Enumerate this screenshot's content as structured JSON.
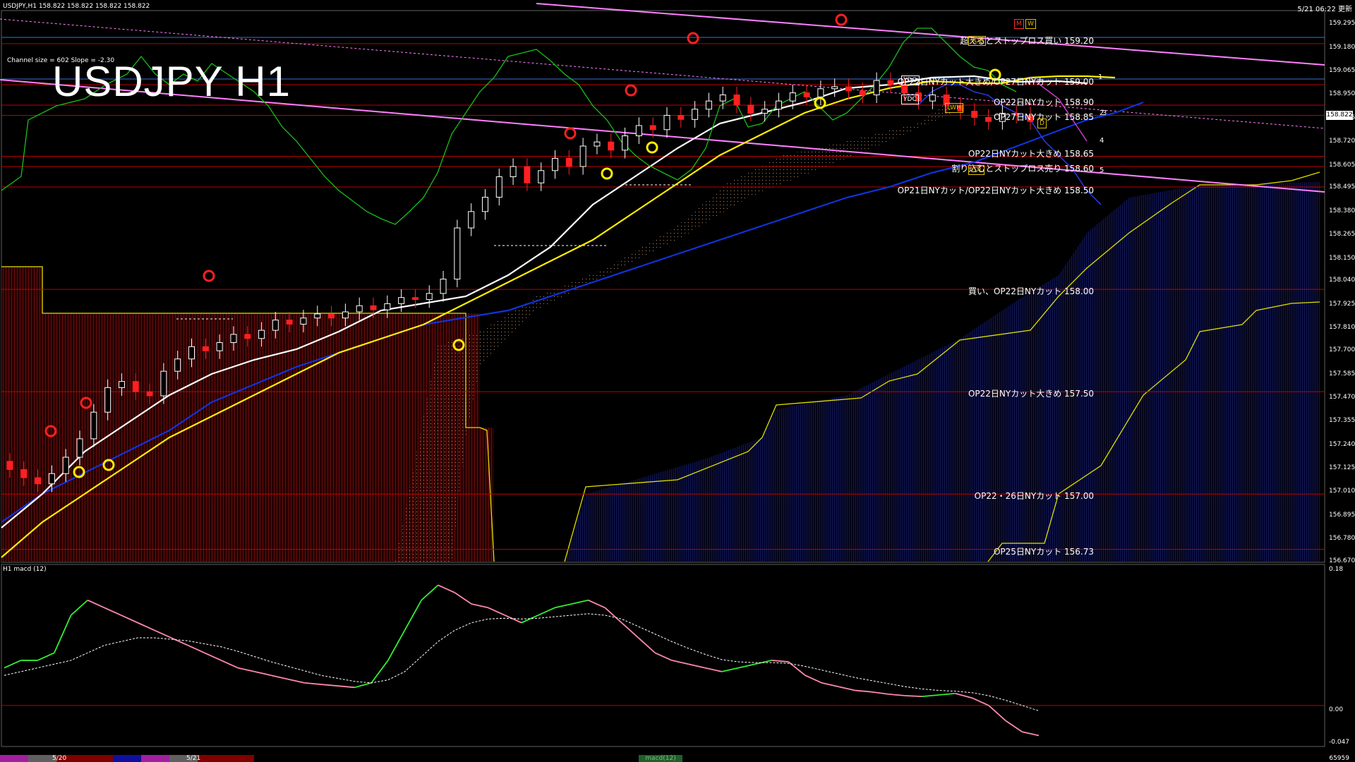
{
  "header": {
    "symbol_info": "USDJPY,H1  158.822 158.822 158.822 158.822",
    "datetime": "5/21 06:22 更新",
    "channel_info": "Channel size = 602 Slope = -2.30",
    "title": "USDJPY H1"
  },
  "macd_panel": {
    "title": "H1  macd (12)",
    "ticks": [
      "0.18",
      "0.00",
      "-0.047"
    ],
    "tab_label": "macd(12)"
  },
  "price_axis": {
    "ticks": [
      "159.295",
      "159.180",
      "159.065",
      "158.950",
      "158.835",
      "158.720",
      "158.605",
      "158.495",
      "158.380",
      "158.265",
      "158.150",
      "158.040",
      "157.925",
      "157.810",
      "157.700",
      "157.585",
      "157.470",
      "157.355",
      "157.240",
      "157.125",
      "157.010",
      "156.895",
      "156.780",
      "156.670"
    ],
    "current_price": "158.822"
  },
  "levels": [
    {
      "label": "超えるとストップロス買い 159.20",
      "price": 159.2
    },
    {
      "label": "OP22日NYカット大きめ/OP27日NYカット 159.00",
      "price": 159.0
    },
    {
      "label": "OP22日NYカット 158.90",
      "price": 158.9
    },
    {
      "label": "OP27日NYカット 158.85",
      "price": 158.85
    },
    {
      "label": "OP22日NYカット大きめ 158.65",
      "price": 158.65
    },
    {
      "label": "割り込むとストップロス売り 158.60",
      "price": 158.6
    },
    {
      "label": "OP21日NYカット/OP22日NYカット大きめ 158.50",
      "price": 158.5
    },
    {
      "label": "買い、OP22日NYカット 158.00",
      "price": 158.0
    },
    {
      "label": "OP22日NYカット大きめ 157.50",
      "price": 157.5
    },
    {
      "label": "OP22・26日NYカット 157.00",
      "price": 157.0
    },
    {
      "label": "OP25日NYカット 156.73",
      "price": 156.73
    }
  ],
  "markers": {
    "ydh": "YDH",
    "ydo": "YDO",
    "ydc": "YDC",
    "ydl": "YDL",
    "lwh": "LWH",
    "m": "M",
    "w": "W",
    "d": "D",
    "wave_labels": [
      "1",
      "2",
      "3",
      "4",
      "5"
    ]
  },
  "bottom_bar": {
    "dates": [
      "5/20",
      "5/21"
    ],
    "right_number": "65959"
  },
  "chart_data": {
    "type": "candlestick",
    "symbol": "USDJPY",
    "timeframe": "H1",
    "ylim": [
      156.67,
      159.31
    ],
    "closes": [
      157.12,
      157.08,
      157.05,
      157.1,
      157.18,
      157.27,
      157.4,
      157.52,
      157.55,
      157.5,
      157.48,
      157.6,
      157.66,
      157.72,
      157.7,
      157.74,
      157.78,
      157.76,
      157.8,
      157.85,
      157.83,
      157.86,
      157.88,
      157.86,
      157.89,
      157.92,
      157.9,
      157.93,
      157.96,
      157.95,
      157.98,
      158.05,
      158.3,
      158.38,
      158.45,
      158.55,
      158.6,
      158.52,
      158.58,
      158.64,
      158.6,
      158.7,
      158.72,
      158.68,
      158.75,
      158.8,
      158.78,
      158.85,
      158.83,
      158.88,
      158.92,
      158.95,
      158.9,
      158.86,
      158.88,
      158.92,
      158.96,
      158.94,
      158.98,
      158.99,
      158.97,
      158.95,
      159.02,
      159.0,
      158.96,
      158.92,
      158.95,
      158.9,
      158.87,
      158.84,
      158.82,
      158.86,
      158.85,
      158.82
    ],
    "hull_midline": [],
    "macd": {
      "main": [
        0.05,
        0.06,
        0.06,
        0.07,
        0.12,
        0.14,
        0.13,
        0.12,
        0.11,
        0.1,
        0.09,
        0.08,
        0.07,
        0.06,
        0.05,
        0.045,
        0.04,
        0.035,
        0.03,
        0.028,
        0.026,
        0.024,
        0.03,
        0.06,
        0.1,
        0.14,
        0.16,
        0.15,
        0.135,
        0.13,
        0.12,
        0.11,
        0.12,
        0.13,
        0.135,
        0.14,
        0.13,
        0.11,
        0.09,
        0.07,
        0.06,
        0.055,
        0.05,
        0.045,
        0.05,
        0.055,
        0.06,
        0.058,
        0.04,
        0.03,
        0.025,
        0.02,
        0.018,
        0.015,
        0.013,
        0.012,
        0.014,
        0.016,
        0.01,
        0.0,
        -0.02,
        -0.035,
        -0.04
      ],
      "signal": [
        0.04,
        0.045,
        0.05,
        0.055,
        0.06,
        0.07,
        0.08,
        0.085,
        0.09,
        0.09,
        0.088,
        0.086,
        0.082,
        0.078,
        0.072,
        0.065,
        0.058,
        0.052,
        0.046,
        0.04,
        0.036,
        0.032,
        0.03,
        0.034,
        0.045,
        0.065,
        0.085,
        0.1,
        0.11,
        0.115,
        0.116,
        0.115,
        0.116,
        0.118,
        0.12,
        0.122,
        0.12,
        0.115,
        0.105,
        0.095,
        0.085,
        0.076,
        0.068,
        0.061,
        0.058,
        0.057,
        0.057,
        0.056,
        0.052,
        0.047,
        0.042,
        0.037,
        0.033,
        0.029,
        0.025,
        0.022,
        0.02,
        0.019,
        0.017,
        0.013,
        0.007,
        0.0,
        -0.007
      ]
    }
  },
  "colors": {
    "level_line": "#c00000",
    "blue_hline": "#3a6fd8",
    "channel": "#ff80ff",
    "ma_white": "#ffffff",
    "ma_yellow": "#ffee00",
    "ma_blue": "#1133dd",
    "chikou": "#18c018",
    "cloud_red": "#c02020",
    "cloud_blue": "#2030a0",
    "kijun": "#e0e000",
    "macd_up": "#33ee33",
    "macd_down": "#ff88aa"
  }
}
